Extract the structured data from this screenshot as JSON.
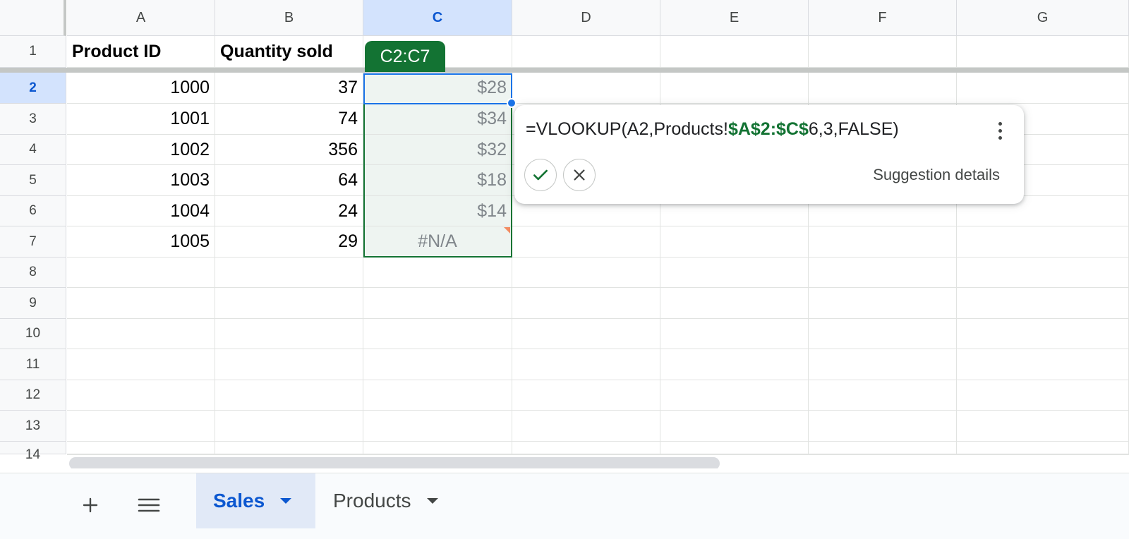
{
  "columns": [
    "A",
    "B",
    "C",
    "D",
    "E",
    "F",
    "G"
  ],
  "rows": [
    "1",
    "2",
    "3",
    "4",
    "5",
    "6",
    "7",
    "8",
    "9",
    "10",
    "11",
    "12",
    "13",
    "14"
  ],
  "header_row": {
    "a": "Product ID",
    "b": "Quantity sold"
  },
  "data_rows": [
    {
      "a": "1000",
      "b": "37",
      "c": "$28"
    },
    {
      "a": "1001",
      "b": "74",
      "c": "$34"
    },
    {
      "a": "1002",
      "b": "356",
      "c": "$32"
    },
    {
      "a": "1003",
      "b": "64",
      "c": "$18"
    },
    {
      "a": "1004",
      "b": "24",
      "c": "$14"
    },
    {
      "a": "1005",
      "b": "29",
      "c": "#N/A"
    }
  ],
  "range_label": "C2:C7",
  "suggestion": {
    "formula_prefix": "=VLOOKUP(A2,Products!",
    "formula_ref": "$A$2:$C$",
    "formula_suffix": "6,3,FALSE)",
    "details_label": "Suggestion details",
    "accept_icon": "check-icon",
    "reject_icon": "close-icon"
  },
  "tabs": {
    "add_icon": "plus-icon",
    "menu_icon": "hamburger-menu-icon",
    "items": [
      {
        "label": "Sales",
        "active": true
      },
      {
        "label": "Products",
        "active": false
      }
    ]
  },
  "colors": {
    "accent_blue": "#0b57d0",
    "range_green": "#137333",
    "selection_blue": "#1a73e8"
  }
}
